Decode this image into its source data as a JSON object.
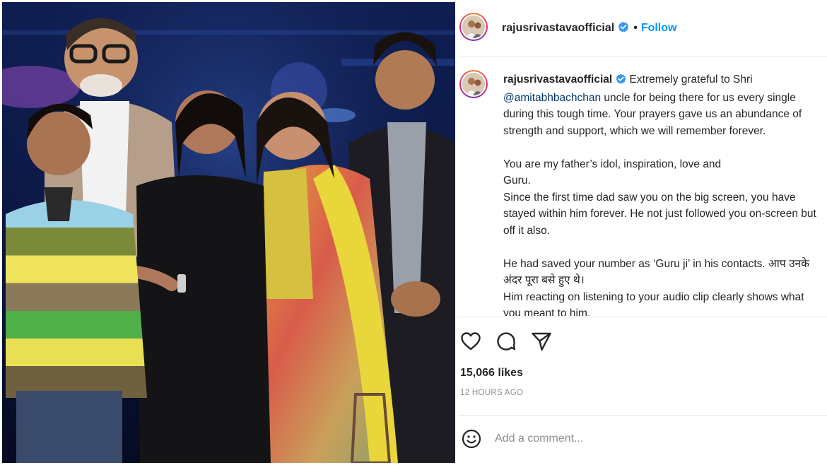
{
  "post": {
    "username": "rajusrivastavaofficial",
    "follow_label": "Follow",
    "separator": "•",
    "caption": {
      "line1_text": "Extremely grateful to Shri",
      "line2_mention": "@amitabhbachchan",
      "line2_text": " uncle for being there for us every single",
      "line3": "during this tough time. Your prayers gave us an abundance of",
      "line4": "strength and support, which we will remember forever.",
      "line5": "You are my father’s idol, inspiration, love and",
      "line6": "Guru.",
      "line7": "Since the first time dad saw you on the big screen, you have",
      "line8": "stayed within him forever. He not just followed you on-screen but",
      "line9": "off it also.",
      "line10": "He had saved your number as ‘Guru ji’ in his contacts. आप उनके",
      "line11": "अंदर पूरा बसे हुए थे।",
      "line12": "Him reacting on listening to your audio clip clearly shows what",
      "line13": "you meant to him."
    },
    "likes": "15,066 likes",
    "time_ago": "12 HOURS AGO",
    "comment_placeholder": "Add a comment..."
  },
  "icons": {
    "verified": "verified-badge-icon",
    "like": "heart-icon",
    "comment": "comment-bubble-icon",
    "share": "paper-plane-icon",
    "emoji": "smiley-icon"
  },
  "colors": {
    "link_blue": "#0095f6",
    "mention_blue": "#00376b",
    "verified_blue": "#3897f0",
    "muted_gray": "#8e8e8e",
    "divider": "#e6e6e6"
  }
}
